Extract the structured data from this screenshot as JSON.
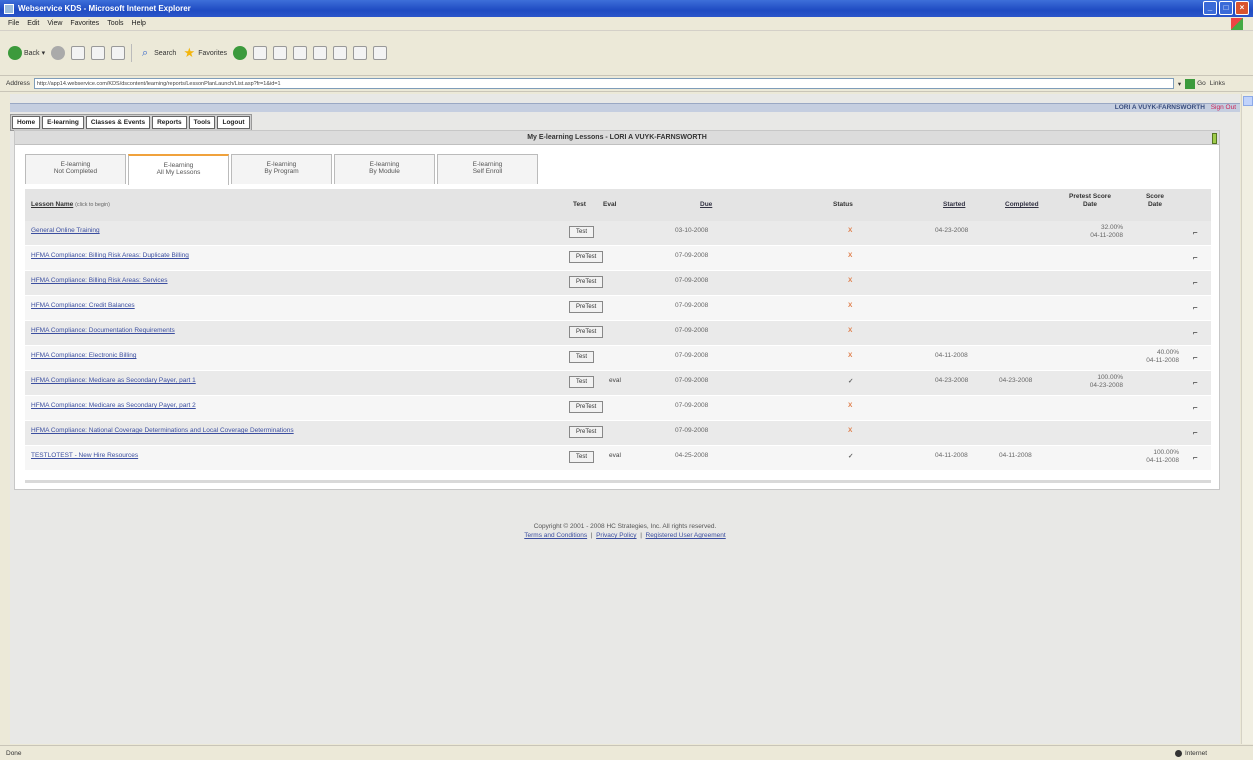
{
  "window": {
    "title": "Webservice KDS - Microsoft Internet Explorer"
  },
  "menu": [
    "File",
    "Edit",
    "View",
    "Favorites",
    "Tools",
    "Help"
  ],
  "toolbar": {
    "back": "Back",
    "search": "Search",
    "favorites": "Favorites"
  },
  "address": {
    "label": "Address",
    "url": "http://app14.webservice.com/KDS/dscontent/learning/reports/LessonPlanLaunch/List.asp?fr=1&id=1",
    "go": "Go",
    "links": "Links"
  },
  "header": {
    "user": "LORI A VUYK-FARNSWORTH",
    "signout": "Sign Out"
  },
  "nav": [
    "Home",
    "E-learning",
    "Classes & Events",
    "Reports",
    "Tools",
    "Logout"
  ],
  "panel": {
    "title": "My E-learning Lessons - LORI A VUYK-FARNSWORTH"
  },
  "tabs": [
    {
      "line1": "E-learning",
      "line2": "Not Completed"
    },
    {
      "line1": "E-learning",
      "line2": "All My Lessons"
    },
    {
      "line1": "E-learning",
      "line2": "By Program"
    },
    {
      "line1": "E-learning",
      "line2": "By Module"
    },
    {
      "line1": "E-learning",
      "line2": "Self Enroll"
    }
  ],
  "columns": {
    "lesson": "Lesson Name",
    "lesson_hint": "(click to begin)",
    "test": "Test",
    "eval": "Eval",
    "due": "Due",
    "status": "Status",
    "started": "Started",
    "completed": "Completed",
    "pretest_1": "Pretest Score",
    "pretest_2": "Date",
    "score_1": "Score",
    "score_2": "Date"
  },
  "rows": [
    {
      "name": "General Online Training",
      "test": "Test",
      "eval": "",
      "due": "03-10-2008",
      "status": "X",
      "started": "04-23-2008",
      "completed": "",
      "pretest": "32.00%",
      "pretest_date": "04-11-2008",
      "score": "",
      "score_date": ""
    },
    {
      "name": "HFMA Compliance: Billing Risk Areas: Duplicate Billing",
      "test": "PreTest",
      "eval": "",
      "due": "07-09-2008",
      "status": "X",
      "started": "",
      "completed": "",
      "pretest": "",
      "pretest_date": "",
      "score": "",
      "score_date": ""
    },
    {
      "name": "HFMA Compliance: Billing Risk Areas: Services",
      "test": "PreTest",
      "eval": "",
      "due": "07-09-2008",
      "status": "X",
      "started": "",
      "completed": "",
      "pretest": "",
      "pretest_date": "",
      "score": "",
      "score_date": ""
    },
    {
      "name": "HFMA Compliance: Credit Balances",
      "test": "PreTest",
      "eval": "",
      "due": "07-09-2008",
      "status": "X",
      "started": "",
      "completed": "",
      "pretest": "",
      "pretest_date": "",
      "score": "",
      "score_date": ""
    },
    {
      "name": "HFMA Compliance: Documentation Requirements",
      "test": "PreTest",
      "eval": "",
      "due": "07-09-2008",
      "status": "X",
      "started": "",
      "completed": "",
      "pretest": "",
      "pretest_date": "",
      "score": "",
      "score_date": ""
    },
    {
      "name": "HFMA Compliance: Electronic Billing",
      "test": "Test",
      "eval": "",
      "due": "07-09-2008",
      "status": "X",
      "started": "04-11-2008",
      "completed": "",
      "pretest": "",
      "pretest_date": "",
      "score": "40.00%",
      "score_date": "04-11-2008"
    },
    {
      "name": "HFMA Compliance: Medicare as Secondary Payer, part 1",
      "test": "Test",
      "eval": "eval",
      "due": "07-09-2008",
      "status": "✓",
      "started": "04-23-2008",
      "completed": "04-23-2008",
      "pretest": "100.00%",
      "pretest_date": "04-23-2008",
      "score": "",
      "score_date": ""
    },
    {
      "name": "HFMA Compliance: Medicare as Secondary Payer, part 2",
      "test": "PreTest",
      "eval": "",
      "due": "07-09-2008",
      "status": "X",
      "started": "",
      "completed": "",
      "pretest": "",
      "pretest_date": "",
      "score": "",
      "score_date": ""
    },
    {
      "name": "HFMA Compliance: National Coverage Determinations and Local Coverage Determinations",
      "test": "PreTest",
      "eval": "",
      "due": "07-09-2008",
      "status": "X",
      "started": "",
      "completed": "",
      "pretest": "",
      "pretest_date": "",
      "score": "",
      "score_date": ""
    },
    {
      "name": "TESTLOTEST - New Hire Resources",
      "test": "Test",
      "eval": "eval",
      "due": "04-25-2008",
      "status": "✓",
      "started": "04-11-2008",
      "completed": "04-11-2008",
      "pretest": "",
      "pretest_date": "",
      "score": "100.00%",
      "score_date": "04-11-2008"
    }
  ],
  "footer": {
    "copyright": "Copyright © 2001 - 2008 HC Strategies, Inc. All rights reserved.",
    "terms": "Terms and Conditions",
    "privacy": "Privacy Policy",
    "agreement": "Registered User Agreement",
    "sep": "|"
  },
  "status": {
    "left": "Done",
    "zone": "Internet"
  },
  "colors": {
    "accent": "#f0a23c",
    "link": "#3b4ea0",
    "status_x": "#e0804d"
  }
}
